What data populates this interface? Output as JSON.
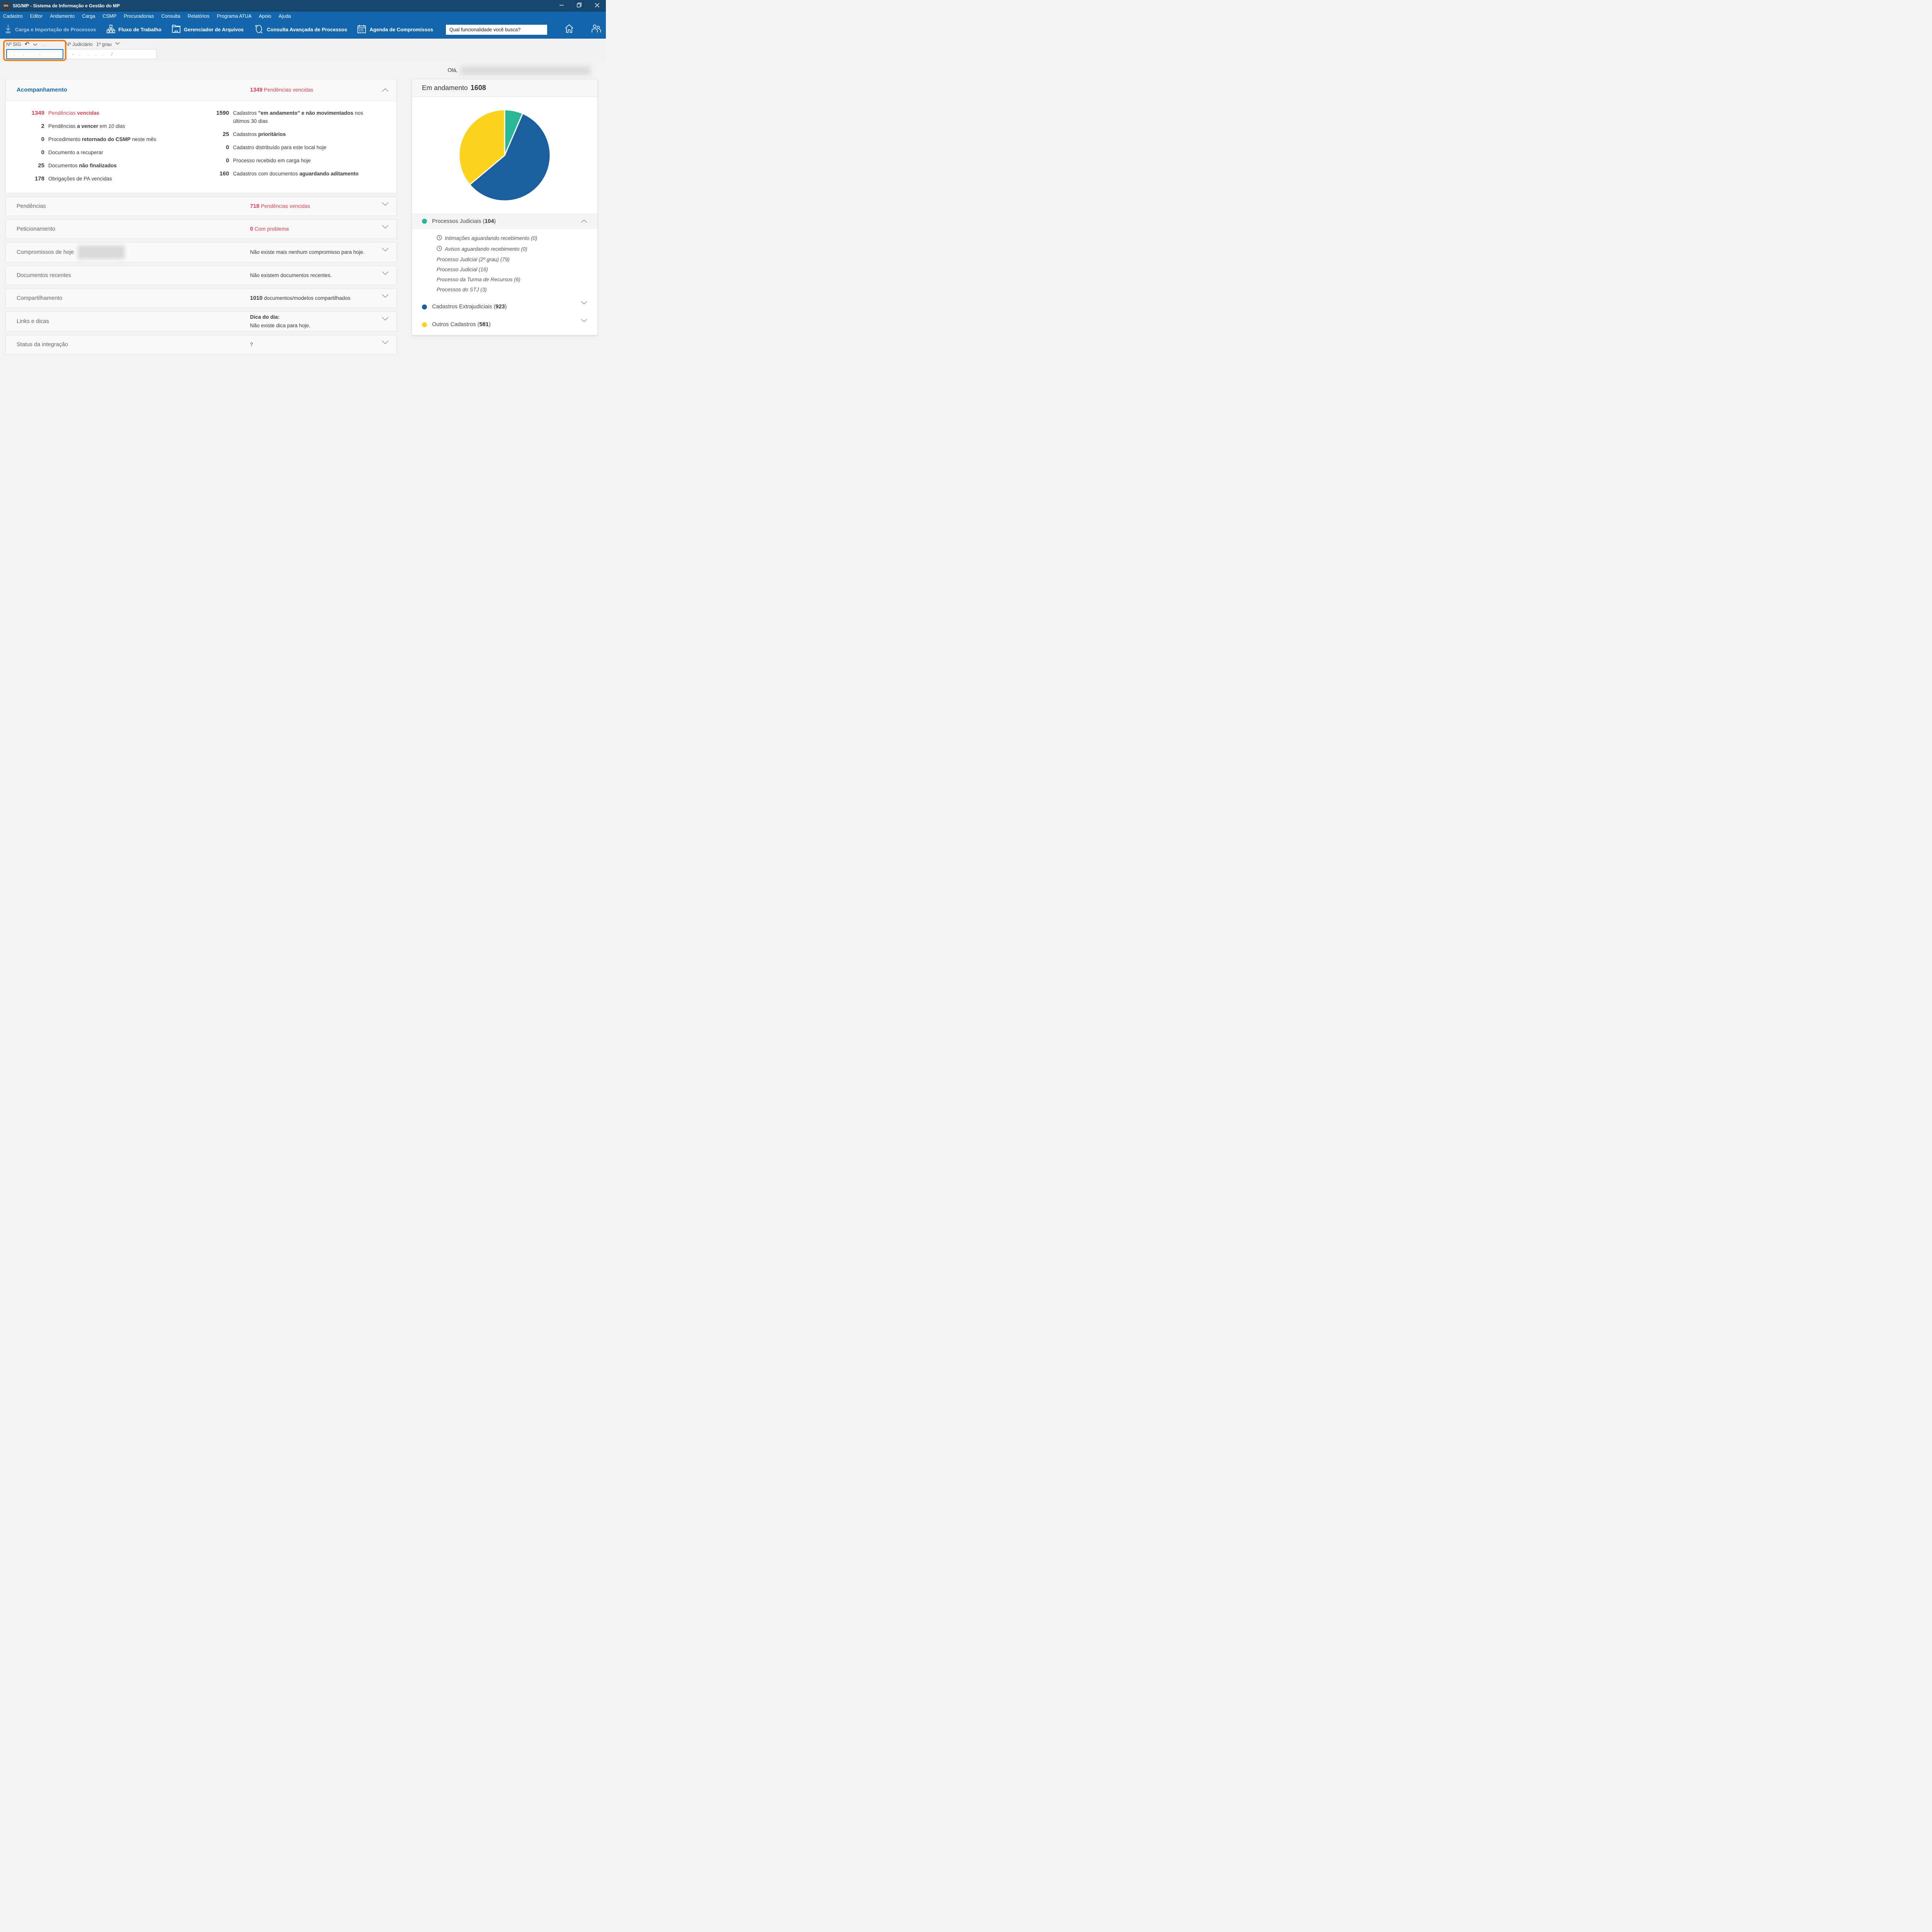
{
  "window": {
    "title": "SIG/MP - Sistema de Informação e Gestão do MP",
    "app_badge": "SIG"
  },
  "menu": {
    "items": [
      "Cadastro",
      "Editor",
      "Andamento",
      "Carga",
      "CSMP",
      "Procuradorias",
      "Consulta",
      "Relatórios",
      "Programa ATUA",
      "Apoio",
      "Ajuda"
    ]
  },
  "toolbar": {
    "buttons": [
      {
        "label": "Carga e Importação de Processos",
        "icon": "download-icon"
      },
      {
        "label": "Fluxo de Trabalho",
        "icon": "workflow-icon"
      },
      {
        "label": "Gerenciador de Arquivos",
        "icon": "file-manager-icon"
      },
      {
        "label": "Consulta Avançada de Processos",
        "icon": "advanced-search-icon"
      },
      {
        "label": "Agenda de Compromissos",
        "icon": "calendar-icon"
      }
    ],
    "search": {
      "placeholder": "Qual funcionalidade você busca?"
    }
  },
  "filters": {
    "sig": {
      "label": "Nº SIG",
      "mask": " .  .    -",
      "undo_glyph": "↶",
      "ellipsis_glyph": "…"
    },
    "judiciario": {
      "label": "Nº Judiciário",
      "grau": "1º grau",
      "mask": " - .  . . .  /"
    }
  },
  "greeting": {
    "prefix": "Olá,"
  },
  "accordion": {
    "acompanhamento": {
      "title": "Acompanhamento",
      "header_count": "1349",
      "header_text": " Pendências vencidas",
      "left_stats": [
        {
          "v": "1349",
          "pre": "Pendências ",
          "b": "vencidas",
          "post": "",
          "it": ""
        },
        {
          "v": "2",
          "pre": "Pendências ",
          "b": "a vencer",
          "post": " em ",
          "it": "10 dias"
        },
        {
          "v": "0",
          "pre": "Procedimento ",
          "b": "retornado do CSMP",
          "post": " neste mês",
          "it": ""
        },
        {
          "v": "0",
          "pre": "Documento a recuperar",
          "b": "",
          "post": "",
          "it": ""
        },
        {
          "v": "25",
          "pre": "Documentos ",
          "b": "não finalizados",
          "post": "",
          "it": ""
        },
        {
          "v": "178",
          "pre": "Obrigações de PA vencidas",
          "b": "",
          "post": "",
          "it": ""
        }
      ],
      "right_stats": [
        {
          "v": "1590",
          "pre": "Cadastros ",
          "b": "\"em andamento\" e não movimentados",
          "post": " nos últimos 30 dias"
        },
        {
          "v": "25",
          "pre": "Cadastros ",
          "b": "prioritários",
          "post": ""
        },
        {
          "v": "0",
          "pre": "Cadastro distribuído para este local hoje",
          "b": "",
          "post": ""
        },
        {
          "v": "0",
          "pre": "Processo recebido em carga hoje",
          "b": "",
          "post": ""
        },
        {
          "v": "160",
          "pre": "Cadastros com documentos ",
          "b": "aguardando aditamento",
          "post": ""
        }
      ]
    },
    "rows": [
      {
        "label": "Pendências",
        "count": "718",
        "text": " Pendências vencidas"
      },
      {
        "label": "Peticionamento",
        "count": "0",
        "text": " Com problema"
      },
      {
        "label": "Compromissos de hoje",
        "text": "Não existe mais nenhum compromisso para hoje."
      },
      {
        "label": "Documentos recentes",
        "text": "Não existem documentos recentes."
      },
      {
        "label": "Compartilhamento",
        "count": "1010",
        "text": " documentos/modelos compartilhados"
      },
      {
        "label": "Links e dicas",
        "tip_title": "Dica do dia:",
        "text": "Não existe dica para hoje."
      },
      {
        "label": "Status da integração",
        "text": "?"
      }
    ]
  },
  "summary": {
    "title": "Em andamento",
    "total": "1608",
    "legend": [
      {
        "pre": "Processos Judiciais (",
        "count": "104",
        "post": ")",
        "color": "#2AB795"
      },
      {
        "pre": "Cadastros Extrajudiciais (",
        "count": "923",
        "post": ")",
        "color": "#1C5F9F"
      },
      {
        "pre": "Outros Cadastros (",
        "count": "581",
        "post": ")",
        "color": "#FBD21C"
      }
    ],
    "judicial_sub": [
      {
        "text": "Intimações aguardando recebimento (0)"
      },
      {
        "text": "Avisos aguardando recebimento (0)"
      },
      {
        "text": "Processo Judicial (2º grau) (79)"
      },
      {
        "text": "Processo Judicial (16)"
      },
      {
        "text": "Processo da Turma de Recursos (6)"
      },
      {
        "text": "Processos do STJ (3)"
      }
    ]
  },
  "chart_data": {
    "type": "pie",
    "title": "Em andamento",
    "total": 1608,
    "start_angle_deg": -90,
    "direction": "clockwise",
    "legend_position": "bottom",
    "series": [
      {
        "label": "Processos Judiciais",
        "value": 104,
        "color": "#2AB795"
      },
      {
        "label": "Cadastros Extrajudiciais",
        "value": 923,
        "color": "#1C5F9F"
      },
      {
        "label": "Outros Cadastros",
        "value": 581,
        "color": "#FBD21C"
      }
    ]
  },
  "colors": {
    "titlebar": "#17476F",
    "menubar": "#1366AC",
    "accent_blue": "#1A67A9",
    "alert_red": "#D9404E",
    "focus_border": "#1478D0",
    "highlight_orange": "#E8831D",
    "pie_green": "#2AB795",
    "pie_blue": "#1C5F9F",
    "pie_yellow": "#FBD21C"
  }
}
